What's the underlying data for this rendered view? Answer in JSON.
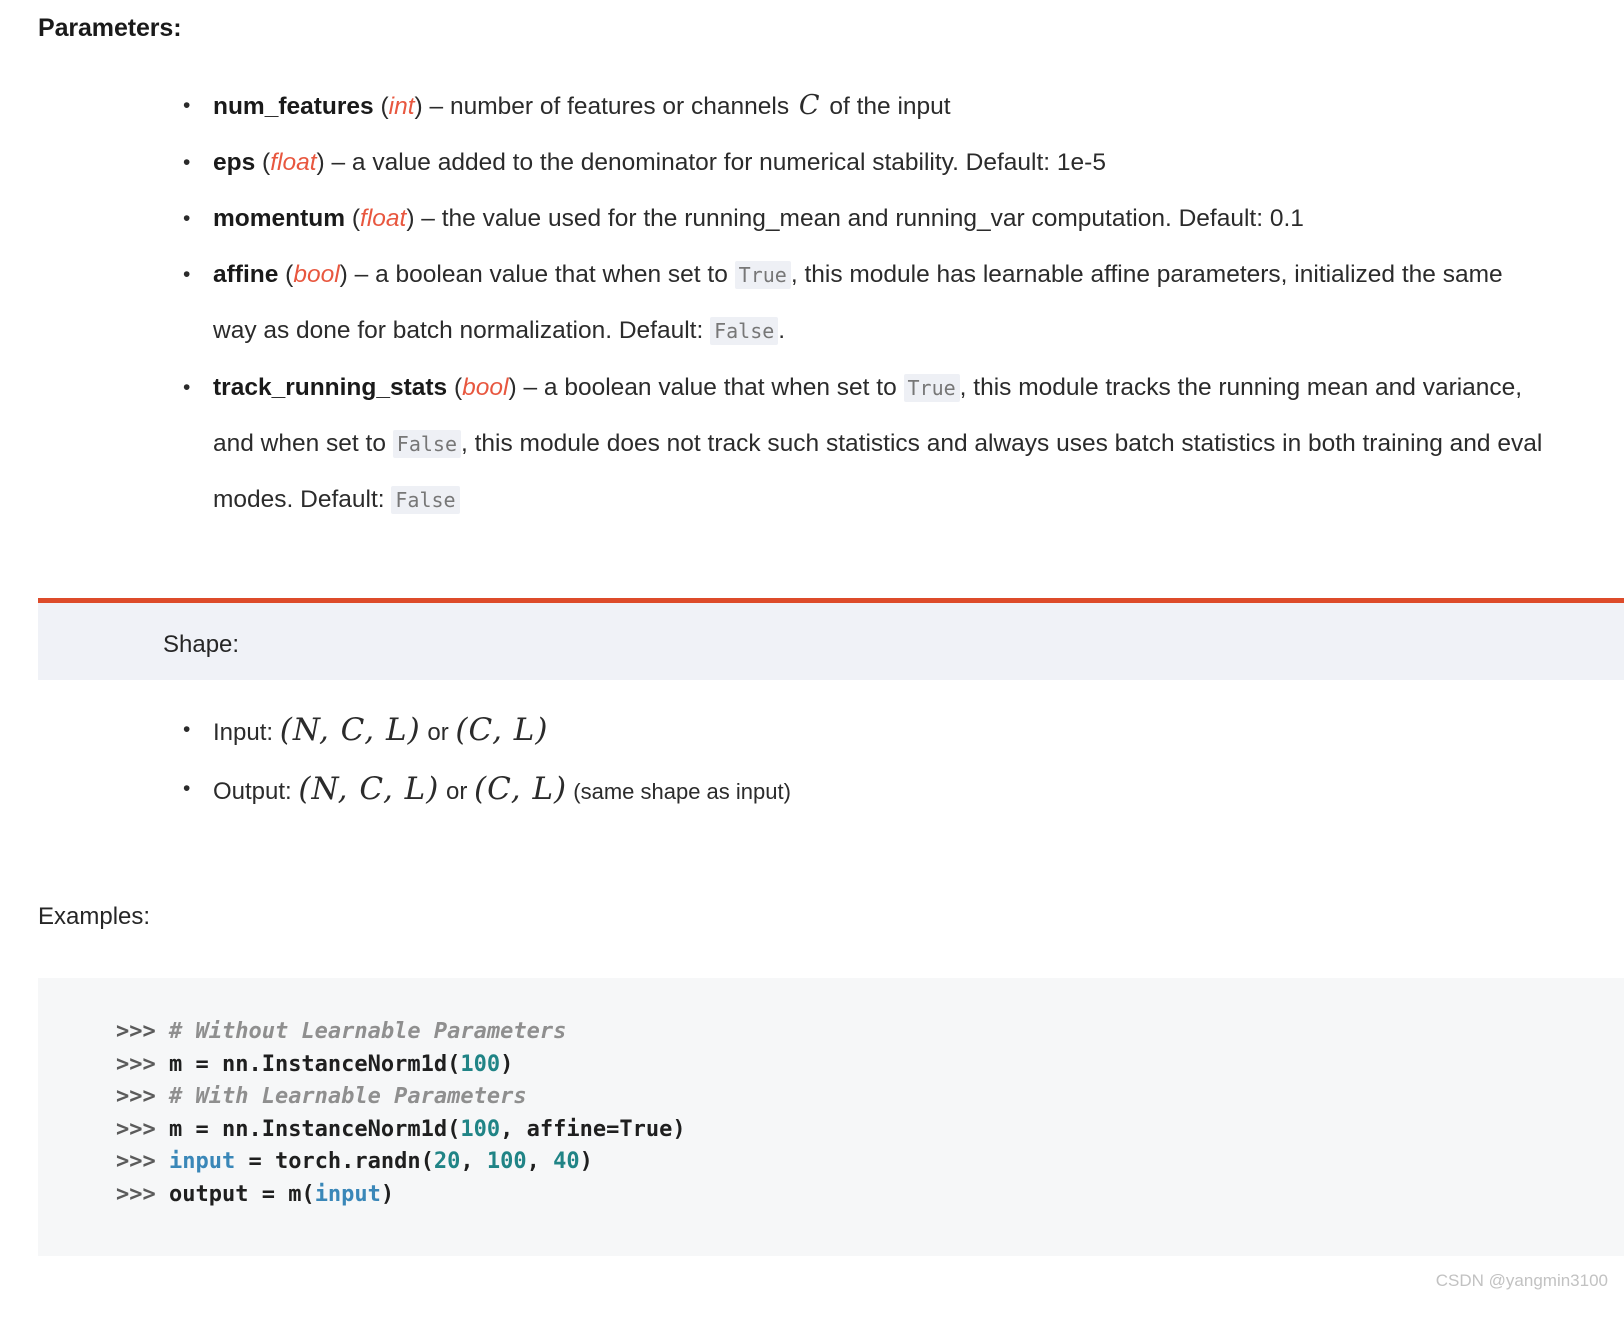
{
  "sections": {
    "parameters_heading": "Parameters:",
    "examples_heading": "Examples:",
    "shape_title": "Shape:"
  },
  "colors": {
    "type_annotation": "#e8573f",
    "admonition_border": "#dd4b2a",
    "admonition_background": "#f0f2f7",
    "code_background": "#f6f7f8",
    "inline_code_background": "#eef0f5",
    "inline_code_text": "#777777",
    "code_number": "#208486",
    "code_builtin": "#3a87b8",
    "code_comment": "#8f8f8f",
    "body_text": "#2b2b2b"
  },
  "parameters": [
    {
      "name": "num_features",
      "type": "int",
      "dash": "–",
      "desc_before": "number of features or channels ",
      "math": "C",
      "desc_after": " of the input"
    },
    {
      "name": "eps",
      "type": "float",
      "dash": "–",
      "desc": "a value added to the denominator for numerical stability. Default: 1e-5"
    },
    {
      "name": "momentum",
      "type": "float",
      "dash": "–",
      "desc": "the value used for the running_mean and running_var computation. Default: 0.1"
    },
    {
      "name": "affine",
      "type": "bool",
      "dash": "–",
      "seg1": "a boolean value that when set to ",
      "code1": "True",
      "seg2": ", this module has learnable affine parameters, initialized the same way as done for batch normalization. Default: ",
      "code2": "False",
      "seg3": "."
    },
    {
      "name": "track_running_stats",
      "type": "bool",
      "dash": "–",
      "seg1": "a boolean value that when set to ",
      "code1": "True",
      "seg2": ", this module tracks the running mean and variance, and when set to ",
      "code2": "False",
      "seg3": ", this module does not track such statistics and always uses batch statistics in both training and eval modes. Default: ",
      "code3": "False"
    }
  ],
  "shape": [
    {
      "label": "Input: ",
      "math1": "(N, C, L)",
      "joiner": " or ",
      "math2": "(C, L)",
      "suffix": ""
    },
    {
      "label": "Output: ",
      "math1": "(N, C, L)",
      "joiner": " or ",
      "math2": "(C, L)",
      "suffix": " (same shape as input)"
    }
  ],
  "code_example": {
    "lines": [
      {
        "prompt": ">>> ",
        "tokens": [
          {
            "t": "# Without Learnable Parameters",
            "c": "comment"
          }
        ]
      },
      {
        "prompt": ">>> ",
        "tokens": [
          {
            "t": "m = nn.InstanceNorm1d(",
            "c": "plain"
          },
          {
            "t": "100",
            "c": "num"
          },
          {
            "t": ")",
            "c": "plain"
          }
        ]
      },
      {
        "prompt": ">>> ",
        "tokens": [
          {
            "t": "# With Learnable Parameters",
            "c": "comment"
          }
        ]
      },
      {
        "prompt": ">>> ",
        "tokens": [
          {
            "t": "m = nn.InstanceNorm1d(",
            "c": "plain"
          },
          {
            "t": "100",
            "c": "num"
          },
          {
            "t": ", affine=True)",
            "c": "plain"
          }
        ]
      },
      {
        "prompt": ">>> ",
        "tokens": [
          {
            "t": "input",
            "c": "builtin"
          },
          {
            "t": " = torch.randn(",
            "c": "plain"
          },
          {
            "t": "20",
            "c": "num"
          },
          {
            "t": ", ",
            "c": "plain"
          },
          {
            "t": "100",
            "c": "num"
          },
          {
            "t": ", ",
            "c": "plain"
          },
          {
            "t": "40",
            "c": "num"
          },
          {
            "t": ")",
            "c": "plain"
          }
        ]
      },
      {
        "prompt": ">>> ",
        "tokens": [
          {
            "t": "output = m(",
            "c": "plain"
          },
          {
            "t": "input",
            "c": "builtin"
          },
          {
            "t": ")",
            "c": "plain"
          }
        ]
      }
    ]
  },
  "watermark": "CSDN @yangmin3100"
}
